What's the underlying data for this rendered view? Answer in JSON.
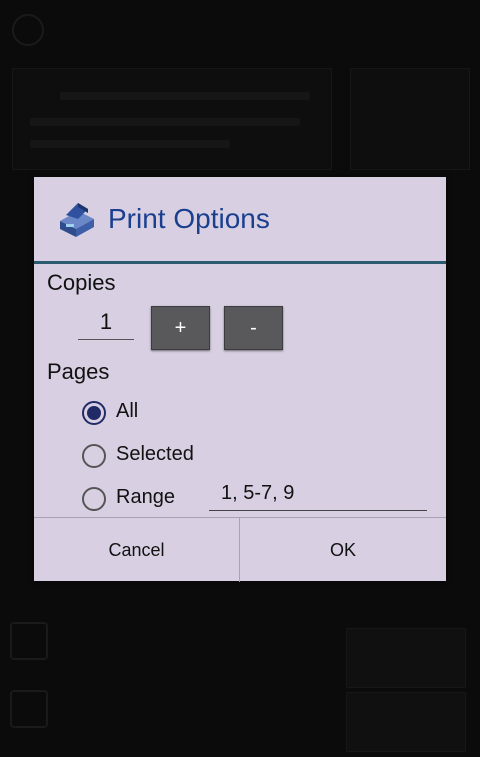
{
  "dialog": {
    "title": "Print Options",
    "icon": "printer-icon",
    "copies": {
      "label": "Copies",
      "value": "1",
      "increment_label": "+",
      "decrement_label": "-"
    },
    "pages": {
      "label": "Pages",
      "options": [
        {
          "label": "All",
          "checked": true
        },
        {
          "label": "Selected",
          "checked": false
        },
        {
          "label": "Range",
          "checked": false
        }
      ],
      "range_value": "1, 5-7, 9"
    },
    "buttons": {
      "cancel": "Cancel",
      "ok": "OK"
    }
  },
  "colors": {
    "dialog_bg": "#d8d0e2",
    "title": "#1b3f8f",
    "accent_divider": "#2c5a6e",
    "stepper_button": "#59595c",
    "radio_checked": "#1f2a66"
  }
}
